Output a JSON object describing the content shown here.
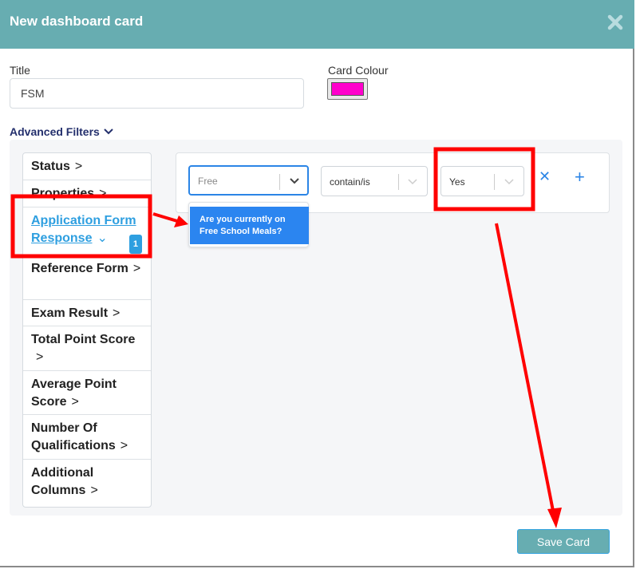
{
  "header": {
    "title": "New dashboard card",
    "close_icon": "close-icon"
  },
  "form": {
    "title_label": "Title",
    "title_value": "FSM",
    "card_colour_label": "Card Colour",
    "card_colour_value": "#ff00cc",
    "advanced_filters_label": "Advanced Filters"
  },
  "categories": [
    {
      "label": "Status"
    },
    {
      "label": "Properties"
    },
    {
      "label": "Application Form Response",
      "active": true,
      "badge": "1"
    },
    {
      "label": "Reference Form"
    },
    {
      "label": "Exam Result"
    },
    {
      "label": "Total Point Score"
    },
    {
      "label": "Average Point Score"
    },
    {
      "label": "Number Of Qualifications"
    },
    {
      "label": "Additional Columns"
    }
  ],
  "rule": {
    "field_search": "Free",
    "operator": "contain/is",
    "value": "Yes",
    "dropdown_options": [
      "Are you currently on Free School Meals?"
    ]
  },
  "footer": {
    "save_label": "Save Card"
  },
  "colors": {
    "header": "#67adb1",
    "accent": "#2b85e6",
    "annotation": "#ff0000"
  }
}
